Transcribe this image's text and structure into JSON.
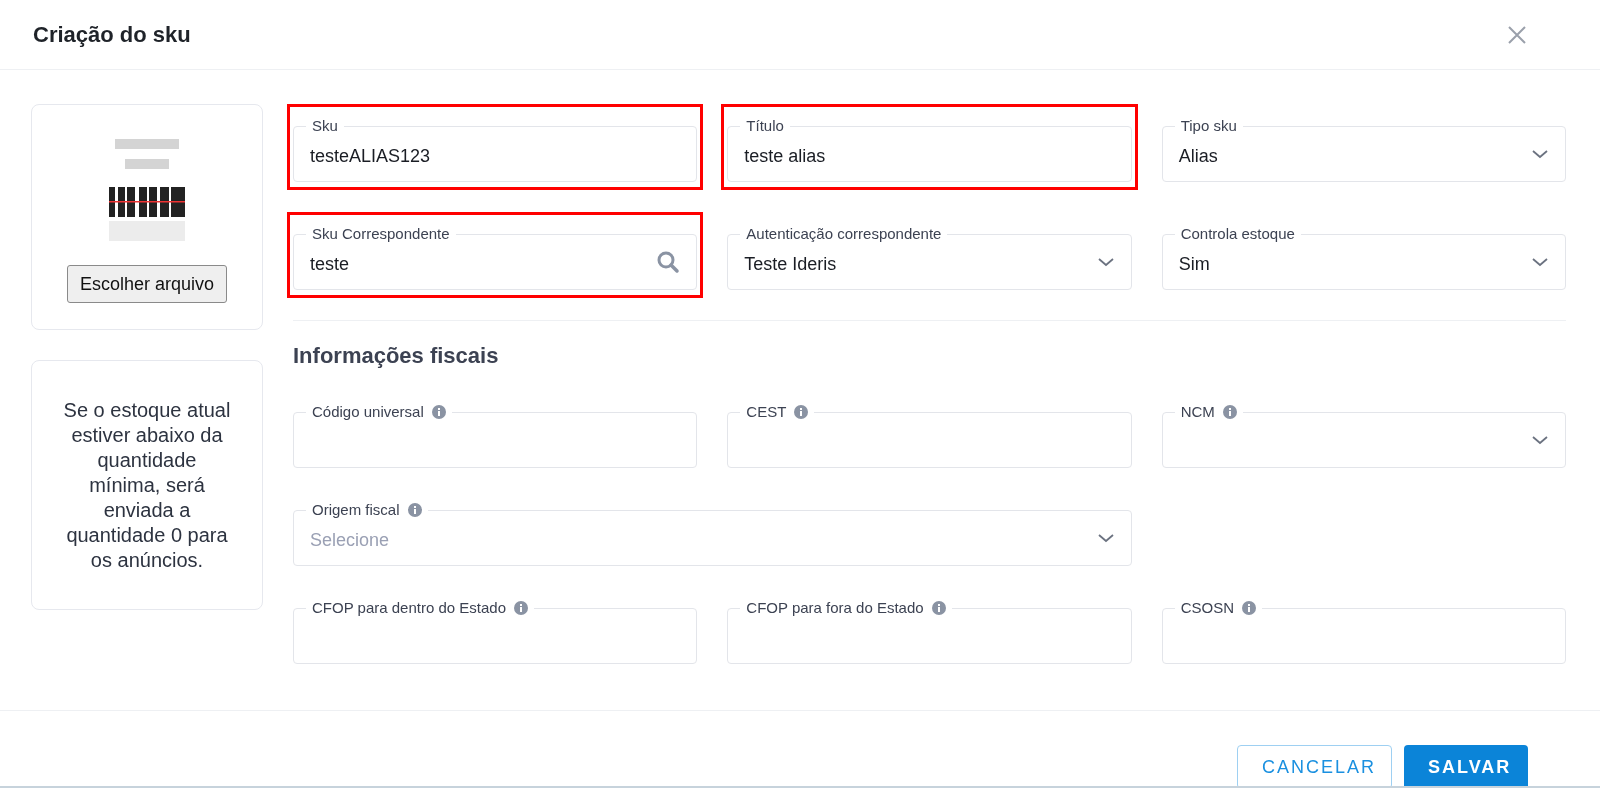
{
  "dialog": {
    "title": "Criação do sku"
  },
  "image_card": {
    "file_button": "Escolher arquivo"
  },
  "notice": "Se o estoque atual estiver abaixo da quantidade mínima, será enviada a quantidade 0 para os anúncios.",
  "fields": [
    {
      "kind": "text",
      "label": "Sku",
      "value": "testeALIAS123",
      "highlighted": true
    },
    {
      "kind": "text",
      "label": "Título",
      "value": "teste alias",
      "highlighted": true
    },
    {
      "kind": "select",
      "label": "Tipo sku",
      "value": "Alias",
      "highlighted": false
    },
    {
      "kind": "search",
      "label": "Sku Correspondente",
      "value": "teste",
      "highlighted": true
    },
    {
      "kind": "select",
      "label": "Autenticação correspondente",
      "value": "Teste Ideris",
      "highlighted": false
    },
    {
      "kind": "select",
      "label": "Controla estoque",
      "value": "Sim",
      "highlighted": false
    }
  ],
  "fiscal": {
    "heading": "Informações fiscais",
    "fields": [
      {
        "kind": "text",
        "label": "Código universal",
        "info": true
      },
      {
        "kind": "text",
        "label": "CEST",
        "info": true
      },
      {
        "kind": "select",
        "label": "NCM",
        "info": true
      },
      {
        "kind": "select",
        "label": "Origem fiscal",
        "info": true,
        "placeholder": "Selecione",
        "wide": true
      },
      {
        "kind": "text",
        "label": "CFOP para dentro do Estado",
        "info": true
      },
      {
        "kind": "text",
        "label": "CFOP para fora do Estado",
        "info": true
      },
      {
        "kind": "text",
        "label": "CSOSN",
        "info": true
      }
    ]
  },
  "footer": {
    "buttons": [
      {
        "kind": "secondary",
        "label": "CANCELAR"
      },
      {
        "kind": "primary",
        "label": "SALVAR"
      }
    ]
  }
}
